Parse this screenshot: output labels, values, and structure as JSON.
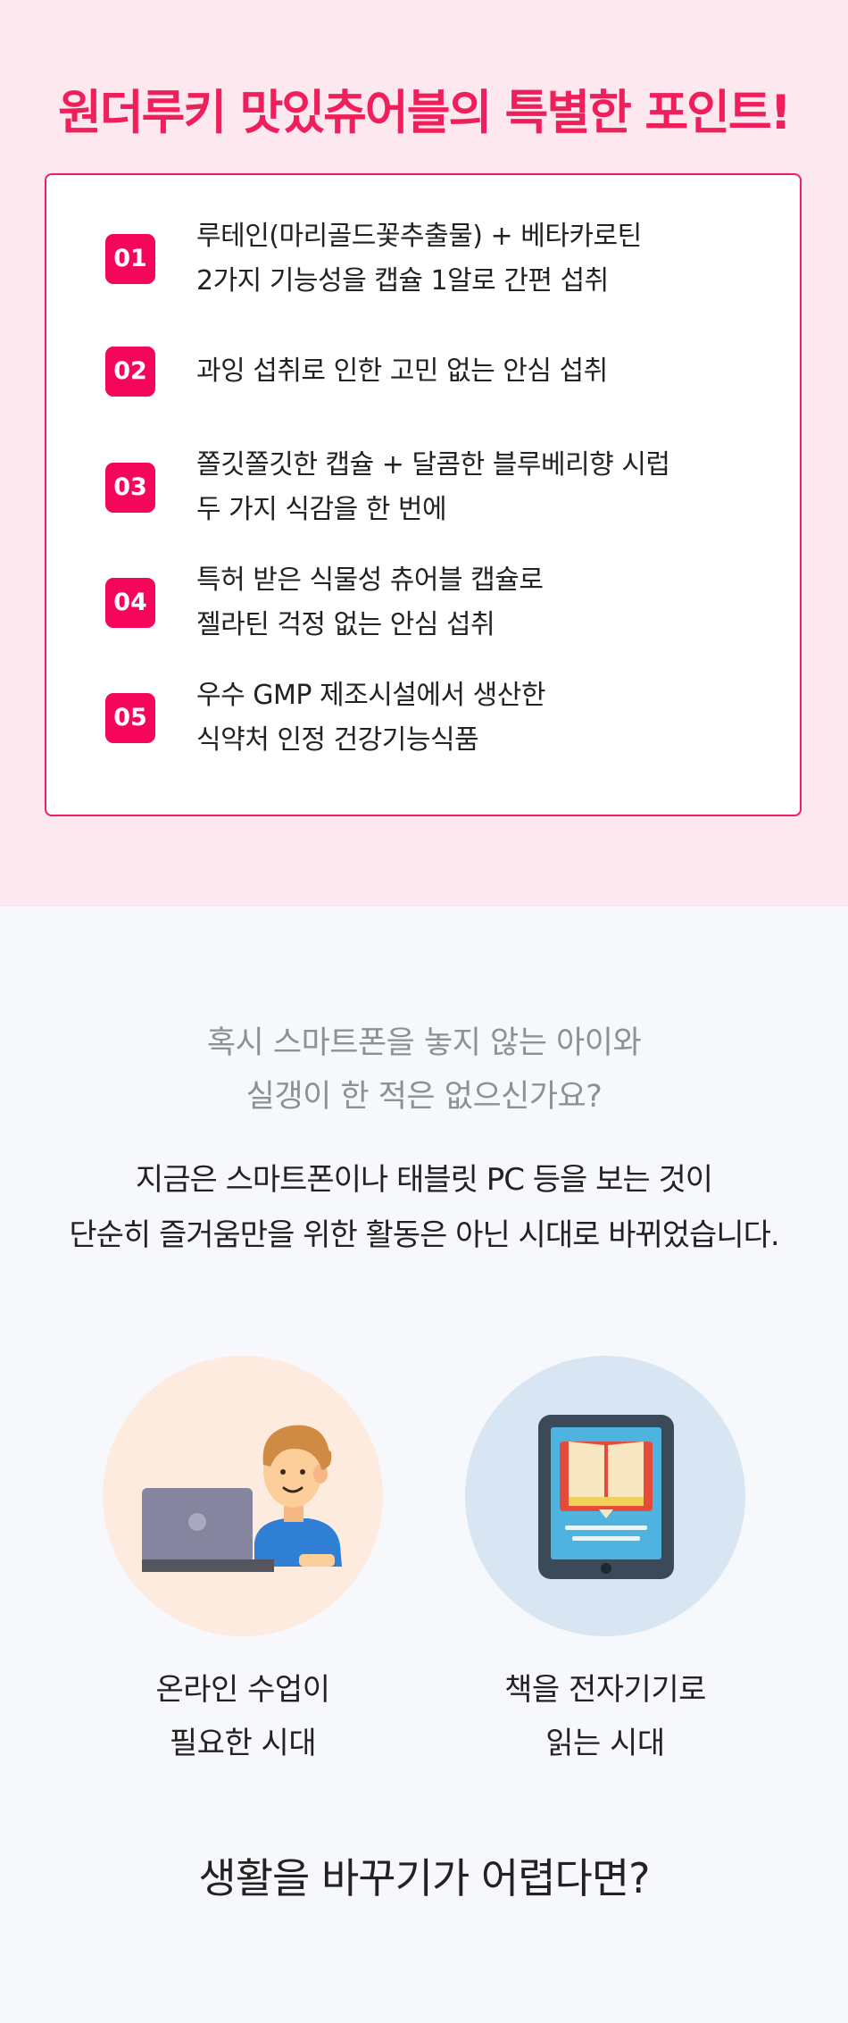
{
  "points_section": {
    "title": "원더루키 맛있츄어블의 특별한 포인트!",
    "items": [
      {
        "num": "01",
        "lines": [
          "루테인(마리골드꽃추출물) + 베타카로틴",
          "2가지 기능성을 캡슐 1알로 간편 섭취"
        ]
      },
      {
        "num": "02",
        "lines": [
          "과잉 섭취로 인한 고민 없는 안심 섭취"
        ]
      },
      {
        "num": "03",
        "lines": [
          "쫄깃쫄깃한 캡슐 + 달콤한 블루베리향 시럽",
          "두 가지 식감을 한 번에"
        ]
      },
      {
        "num": "04",
        "lines": [
          "특허 받은 식물성 츄어블 캡슐로",
          "젤라틴 걱정 없는 안심 섭취"
        ]
      },
      {
        "num": "05",
        "lines": [
          "우수 GMP 제조시설에서 생산한",
          "식약처 인정 건강기능식품"
        ]
      }
    ]
  },
  "lead": {
    "question": [
      "혹시 스마트폰을 놓지 않는 아이와",
      "실갱이 한 적은 없으신가요?"
    ],
    "statement": [
      "지금은 스마트폰이나 태블릿 PC 등을 보는 것이",
      "단순히 즐거움만을 위한 활동은 아닌 시대로 바뀌었습니다."
    ]
  },
  "eras": [
    {
      "icon": "laptop-student-icon",
      "bg_color": "#fdebe0",
      "lines": [
        "온라인 수업이",
        "필요한 시대"
      ]
    },
    {
      "icon": "tablet-book-icon",
      "bg_color": "#d8e5f2",
      "lines": [
        "책을 전자기기로",
        "읽는 시대"
      ]
    }
  ],
  "closing": "생활을 바꾸기가 어렵다면?",
  "colors": {
    "accent": "#ee1f5b",
    "badge": "#f5065a",
    "points_bg": "#fde8ef",
    "page_bg": "#f7f8fb"
  }
}
